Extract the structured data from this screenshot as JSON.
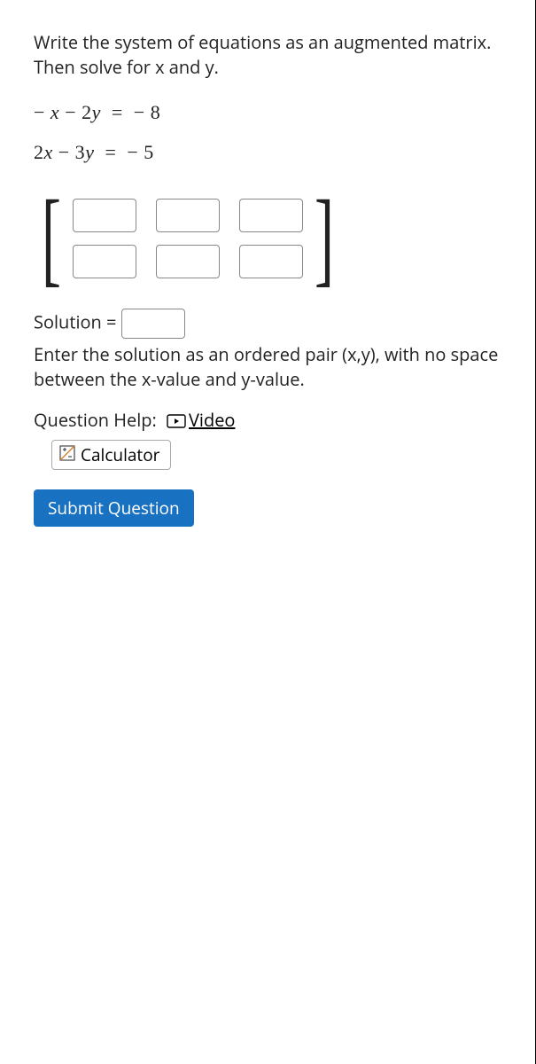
{
  "prompt": "Write the system of equations as an augmented matrix. Then solve for x and y.",
  "equations": {
    "eq1": "− x − 2y =  − 8",
    "eq2": "2x − 3y =  − 5"
  },
  "matrix": {
    "rows": 2,
    "cols": 3
  },
  "solution": {
    "label": "Solution = ",
    "value": ""
  },
  "hint": "Enter the solution as an ordered pair (x,y), with no space between the x-value and y-value.",
  "help": {
    "label": "Question Help:",
    "video": "Video",
    "calculator": "Calculator"
  },
  "submit": "Submit Question"
}
